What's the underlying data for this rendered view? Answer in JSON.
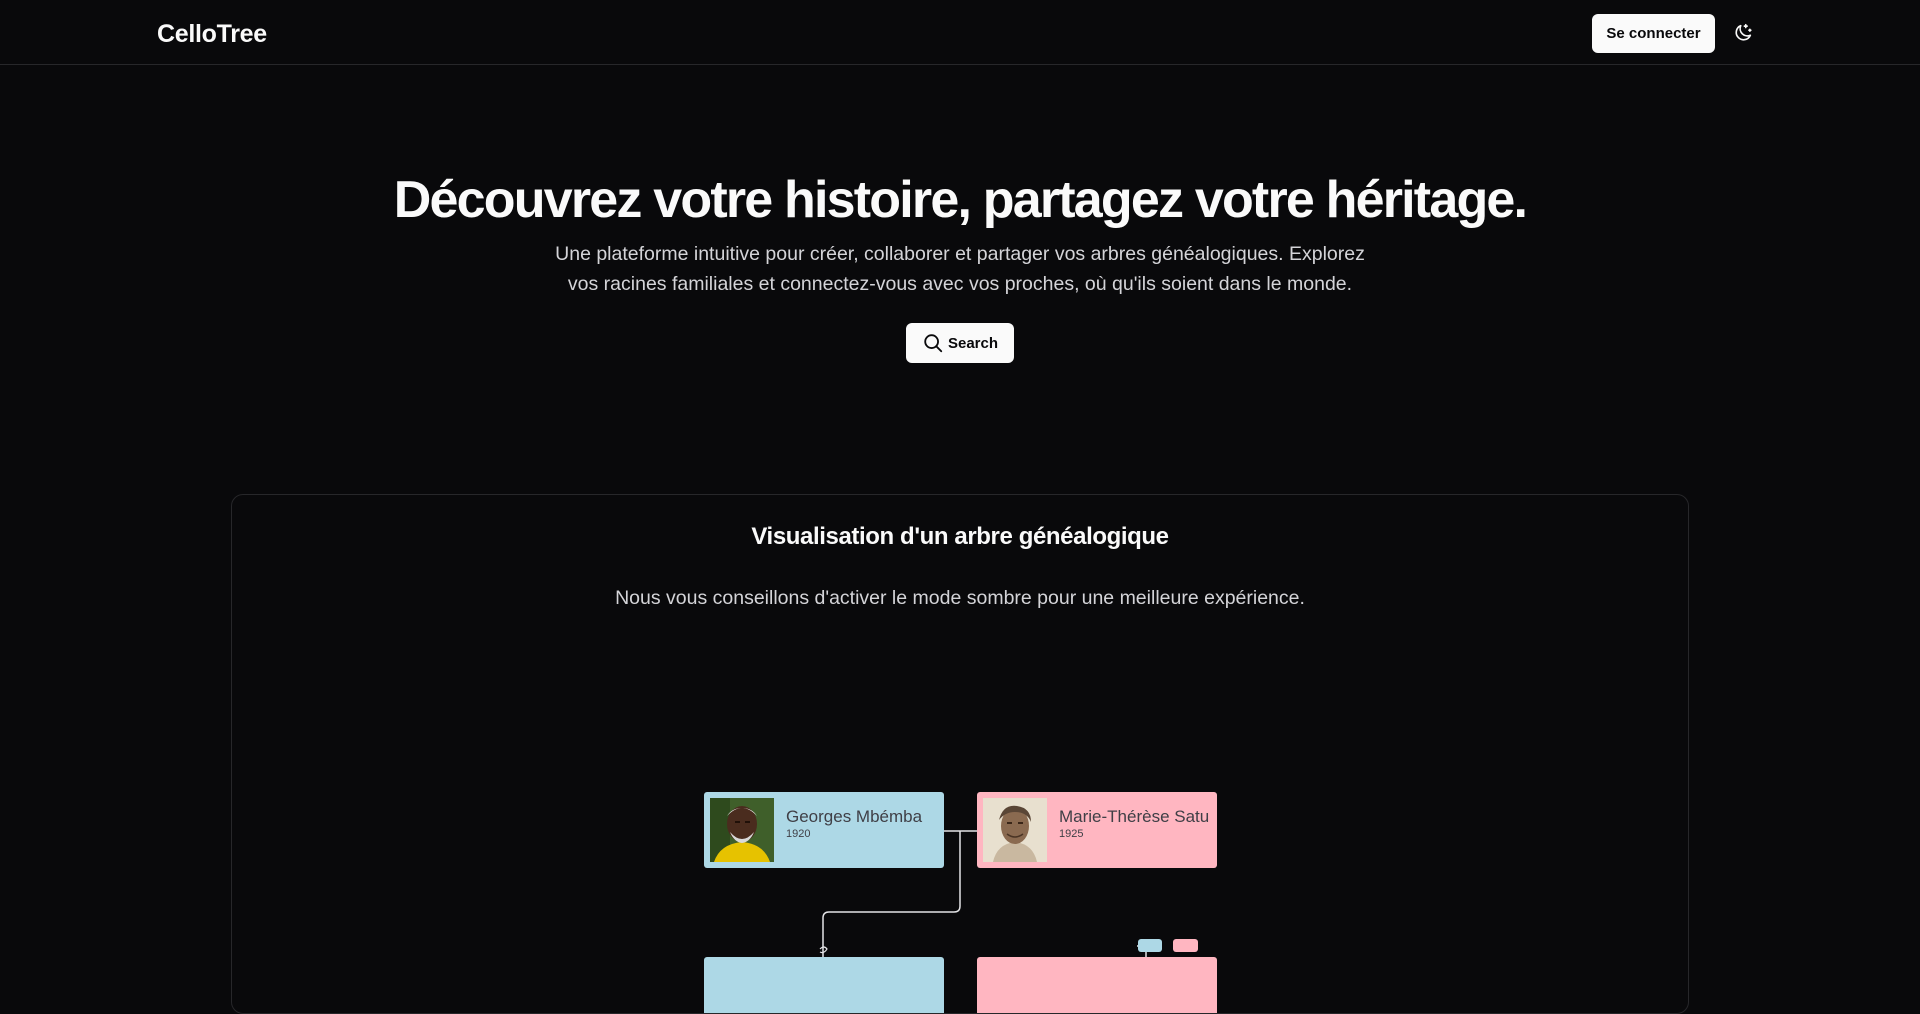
{
  "header": {
    "brand": "CelloTree",
    "login_label": "Se connecter",
    "theme_toggle_icon": "moon-stars-icon"
  },
  "hero": {
    "title": "Découvrez votre histoire, partagez votre héritage.",
    "subtitle_line1": "Une plateforme intuitive pour créer, collaborer et partager vos arbres généalogiques. Explorez",
    "subtitle_line2": "vos racines familiales et connectez-vous avec vos proches, où qu'ils soient dans le monde.",
    "search_label": "Search",
    "search_icon": "search-icon"
  },
  "tree_card": {
    "title": "Visualisation d'un arbre généalogique",
    "subtitle": "Nous vous conseillons d'activer le mode sombre pour une meilleure expérience.",
    "people": [
      {
        "name": "Georges Mbémba",
        "year": "1920",
        "gender": "male"
      },
      {
        "name": "Marie-Thérèse Satu",
        "year": "1925",
        "gender": "female"
      }
    ]
  },
  "colors": {
    "background": "#09090b",
    "male_card": "#add8e6",
    "female_card": "#ffb6c1",
    "border": "#27272a"
  }
}
